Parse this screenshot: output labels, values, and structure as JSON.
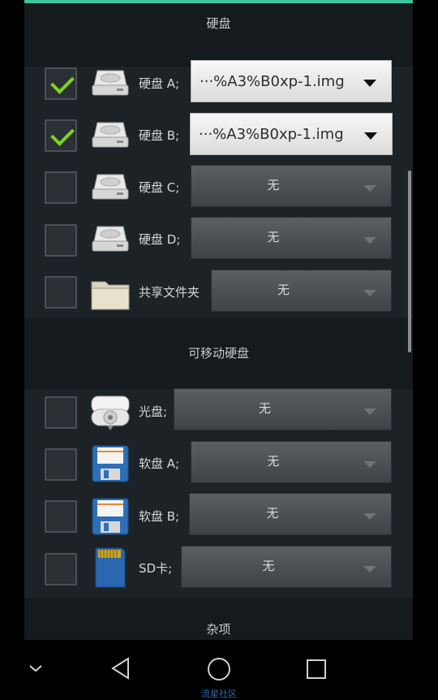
{
  "colors": {
    "accent": "#3fc39a",
    "check": "#7ed321"
  },
  "sections": {
    "hard_disk": "硬盘",
    "removable": "可移动硬盘",
    "misc": "杂项"
  },
  "rows": [
    {
      "label": "硬盘 A;",
      "checked": true,
      "icon": "hard-disk-icon",
      "value": "···%A3%B0xp-1.img"
    },
    {
      "label": "硬盘 B;",
      "checked": true,
      "icon": "hard-disk-icon",
      "value": "···%A3%B0xp-1.img"
    },
    {
      "label": "硬盘 C;",
      "checked": false,
      "icon": "hard-disk-icon",
      "value": "无"
    },
    {
      "label": "硬盘 D;",
      "checked": false,
      "icon": "hard-disk-icon",
      "value": "无"
    },
    {
      "label": "共享文件夹",
      "checked": false,
      "icon": "folder-icon",
      "value": "无"
    },
    {
      "label": "光盘;",
      "checked": false,
      "icon": "cdrom-icon",
      "value": "无"
    },
    {
      "label": "软盘 A;",
      "checked": false,
      "icon": "floppy-icon",
      "value": "无"
    },
    {
      "label": "软盘 B;",
      "checked": false,
      "icon": "floppy-icon",
      "value": "无"
    },
    {
      "label": "SD卡;",
      "checked": false,
      "icon": "sd-card-icon",
      "value": "无"
    }
  ],
  "watermark": "流星社区"
}
